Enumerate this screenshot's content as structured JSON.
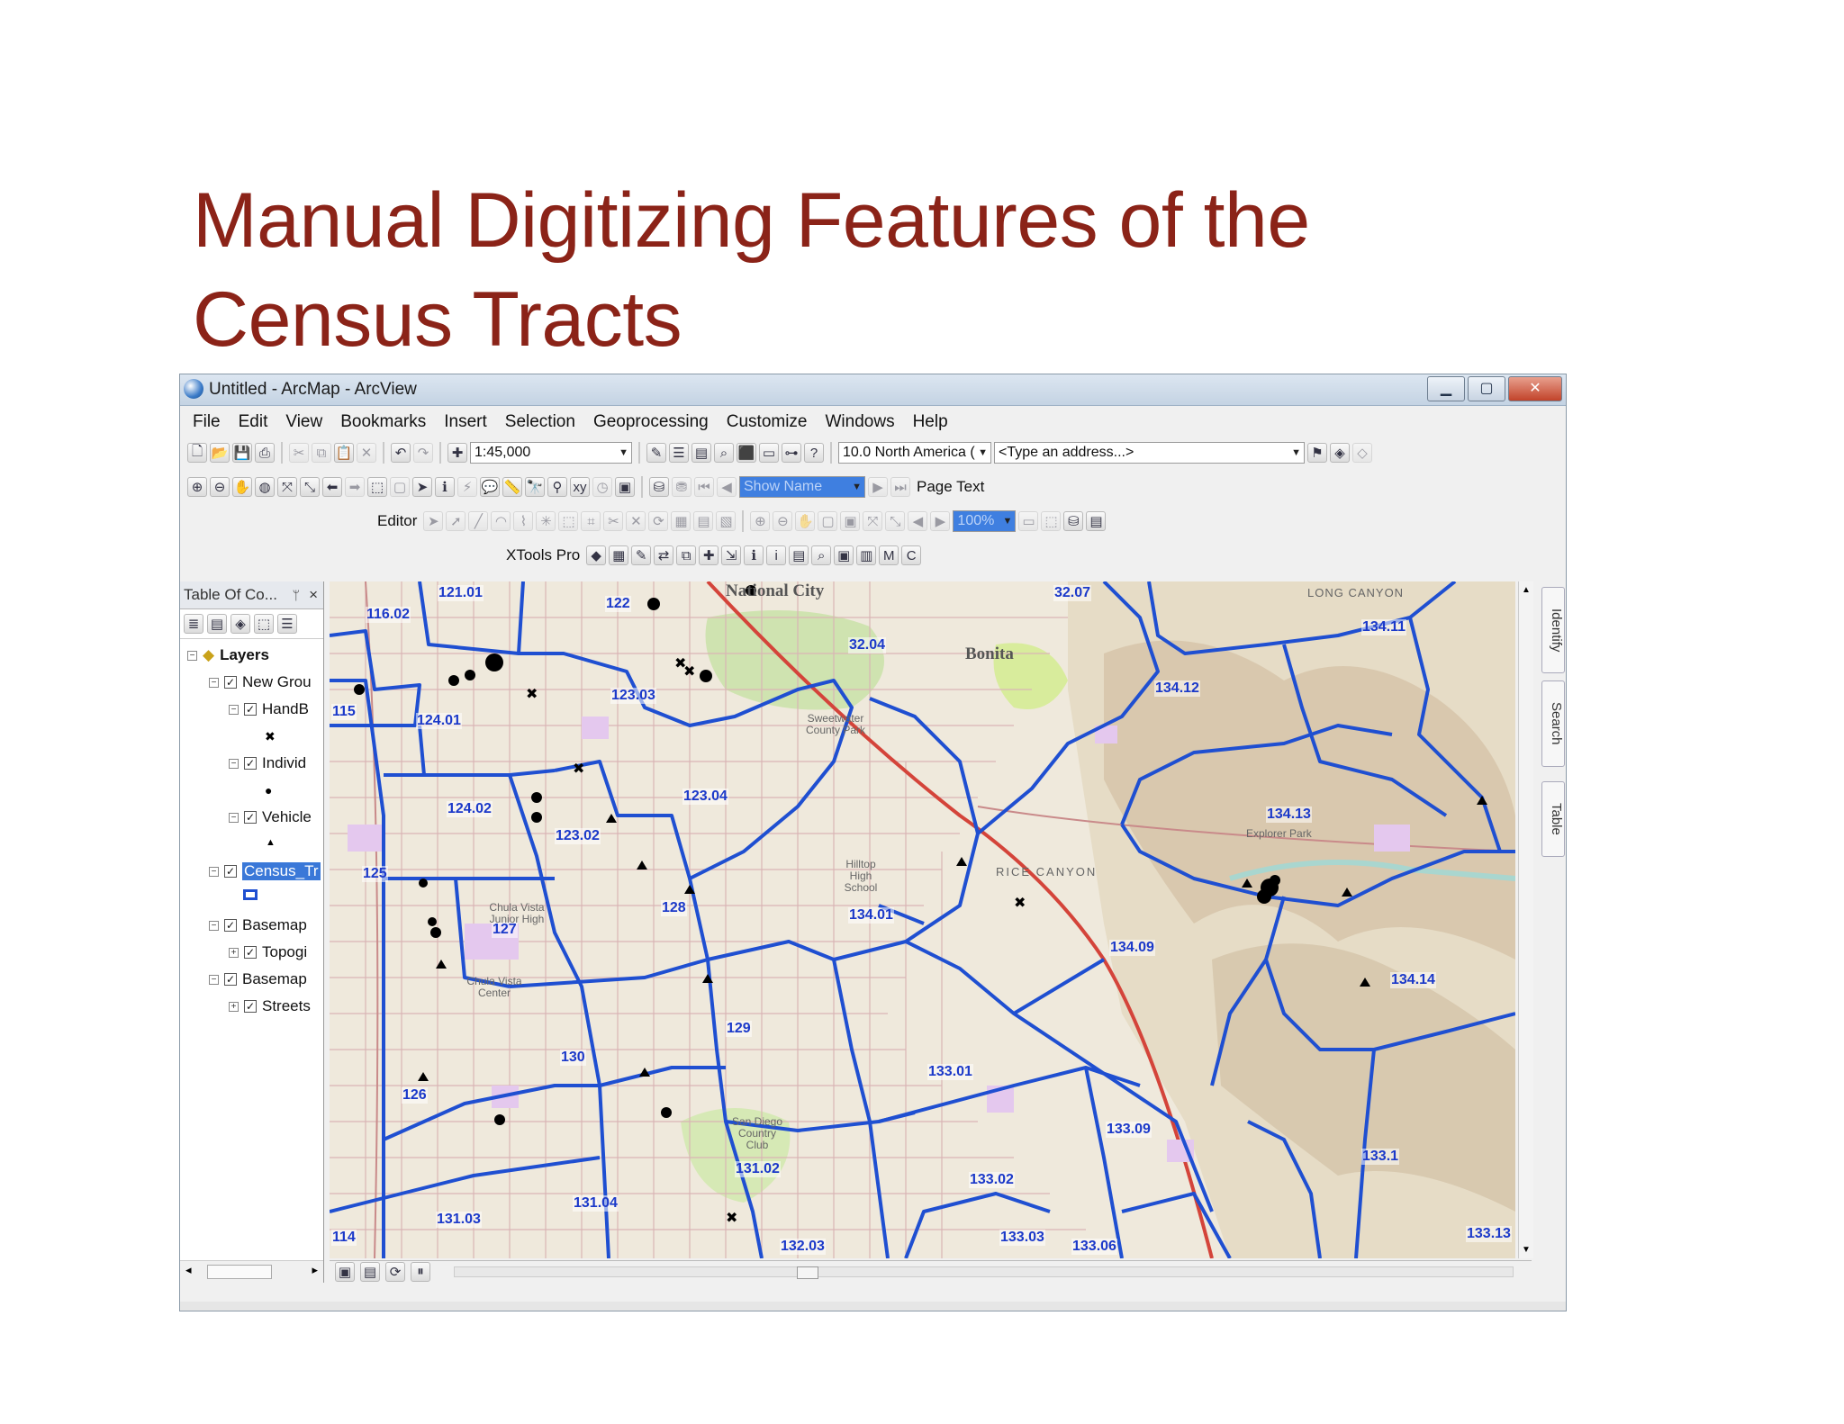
{
  "slide": {
    "title_line1": "Manual Digitizing Features of the",
    "title_line2": "Census Tracts"
  },
  "window": {
    "title": "Untitled - ArcMap - ArcView",
    "minimize": "▁",
    "maximize": "▢",
    "close": "✕"
  },
  "menu": [
    "File",
    "Edit",
    "View",
    "Bookmarks",
    "Insert",
    "Selection",
    "Geoprocessing",
    "Customize",
    "Windows",
    "Help"
  ],
  "toolbar": {
    "scale": "1:45,000",
    "basemap": "10.0 North America (",
    "address_placeholder": "<Type an address...>",
    "show_name": "Show Name",
    "page_text": "Page Text",
    "editor": "Editor",
    "zoom": "100%",
    "xtools": "XTools Pro"
  },
  "toc": {
    "title": "Table Of Co...",
    "pin": "ᛘ",
    "close": "×",
    "layers_label": "Layers",
    "rows": [
      {
        "label": "New Grou"
      },
      {
        "label": "HandB"
      },
      {
        "label": "Individ"
      },
      {
        "label": "Vehicle"
      },
      {
        "label": "Census_Tr"
      },
      {
        "label": "Basemap"
      },
      {
        "label": "Topogi"
      },
      {
        "label": "Basemap"
      },
      {
        "label": "Streets"
      }
    ]
  },
  "map": {
    "tracts": [
      "116.02",
      "121.01",
      "122",
      "32.07",
      "134.11",
      "32.04",
      "123.03",
      "134.12",
      "115",
      "124.01",
      "123.04",
      "134.13",
      "124.02",
      "123.02",
      "125",
      "128",
      "134.01",
      "127",
      "134.09",
      "134.14",
      "129",
      "130",
      "133.01",
      "126",
      "133.09",
      "131.02",
      "133.02",
      "133.1",
      "131.04",
      "131.03",
      "114",
      "133.03",
      "132.03",
      "133.06",
      "133.13"
    ],
    "places": [
      "National City",
      "Bonita",
      "LONG CANYON",
      "Sweetwater County Park",
      "RICE CANYON",
      "Hilltop High School",
      "Chula Vista Junior High",
      "Chula Vista Center",
      "San Diego Country Club",
      "Explorer Park"
    ]
  },
  "side_tabs": [
    "Identify",
    "Search",
    "Table"
  ],
  "colors": {
    "title": "#8b2318",
    "tract_line": "#1f4fd1",
    "tract_label": "#1b39c9",
    "selection": "#3a78d8"
  }
}
